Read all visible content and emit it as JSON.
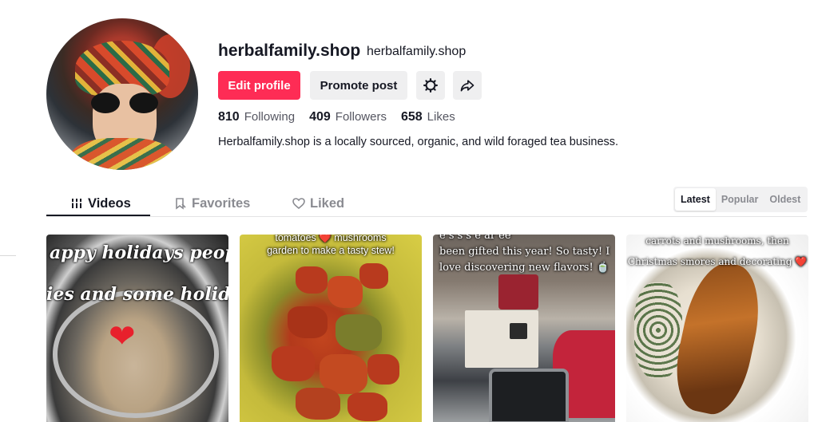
{
  "profile": {
    "username": "herbalfamily.shop",
    "nickname": "herbalfamily.shop",
    "bio": "Herbalfamily.shop is a locally sourced, organic, and wild foraged tea business."
  },
  "actions": {
    "edit_profile": "Edit profile",
    "promote_post": "Promote post",
    "settings_icon": "gear-icon",
    "share_icon": "share-arrow-icon"
  },
  "stats": [
    {
      "value": "810",
      "label": "Following"
    },
    {
      "value": "409",
      "label": "Followers"
    },
    {
      "value": "658",
      "label": "Likes"
    }
  ],
  "tabs": [
    {
      "label": "Videos",
      "icon": "grid-bars-icon",
      "active": true
    },
    {
      "label": "Favorites",
      "icon": "bookmark-icon",
      "active": false
    },
    {
      "label": "Liked",
      "icon": "heart-outline-icon",
      "active": false
    }
  ],
  "sort": {
    "options": [
      "Latest",
      "Popular",
      "Oldest"
    ],
    "selected": "Latest"
  },
  "videos": [
    {
      "caption_lines": [
        "appy holidays peopl",
        "ies and some holida"
      ]
    },
    {
      "caption_lines": [
        "tomatoes ❤️ mushrooms",
        "garden to make a tasty stew!"
      ]
    },
    {
      "caption_lines": [
        "e s s s e ar ee",
        "been gifted this year! So tasty! I",
        "love discovering new flavors! 🍵"
      ]
    },
    {
      "caption_lines": [
        "carrots and mushrooms, then",
        "Christmas smores and decorating ❤️"
      ]
    }
  ],
  "colors": {
    "accent": "#fe2c55",
    "text": "#161823",
    "muted": "#8a8b91"
  }
}
